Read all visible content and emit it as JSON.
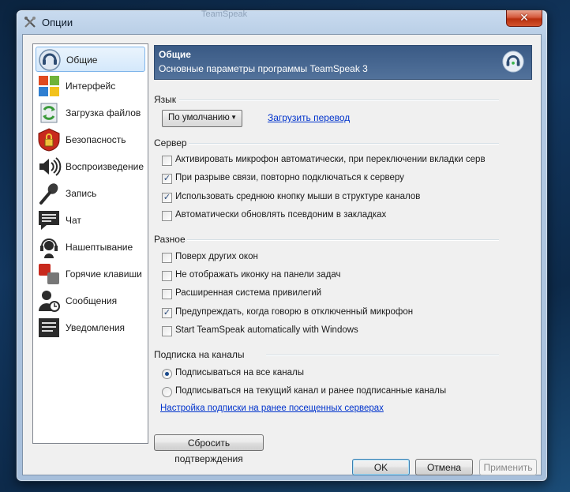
{
  "window": {
    "title": "Опции",
    "ghost_tab": "TeamSpeak",
    "close_symbol": "✕"
  },
  "sidebar": {
    "items": [
      {
        "label": "Общие",
        "icon": "teamspeak-logo-icon",
        "selected": true
      },
      {
        "label": "Интерфейс",
        "icon": "interface-windows-icon"
      },
      {
        "label": "Загрузка файлов",
        "icon": "file-transfer-icon"
      },
      {
        "label": "Безопасность",
        "icon": "security-lock-icon"
      },
      {
        "label": "Воспроизведение",
        "icon": "speaker-icon"
      },
      {
        "label": "Запись",
        "icon": "microphone-icon"
      },
      {
        "label": "Чат",
        "icon": "chat-icon"
      },
      {
        "label": "Нашептывание",
        "icon": "headset-icon"
      },
      {
        "label": "Горячие клавиши",
        "icon": "hotkeys-icon"
      },
      {
        "label": "Сообщения",
        "icon": "messages-user-icon"
      },
      {
        "label": "Уведомления",
        "icon": "notifications-icon"
      }
    ]
  },
  "header": {
    "title": "Общие",
    "subtitle": "Основные параметры программы TeamSpeak 3"
  },
  "language": {
    "group_title": "Язык",
    "dropdown_value": "По умолчанию",
    "load_link": "Загрузить перевод"
  },
  "server": {
    "group_title": "Сервер",
    "options": [
      {
        "label": "Активировать микрофон автоматически, при переключении вкладки серв",
        "checked": false
      },
      {
        "label": "При разрыве связи, повторно подключаться к серверу",
        "checked": true
      },
      {
        "label": "Использовать среднюю кнопку мыши в структуре каналов",
        "checked": true
      },
      {
        "label": "Автоматически обновлять псевдоним в закладках",
        "checked": false
      }
    ]
  },
  "misc": {
    "group_title": "Разное",
    "options": [
      {
        "label": "Поверх других окон",
        "checked": false
      },
      {
        "label": "Не отображать иконку на панели задач",
        "checked": false
      },
      {
        "label": "Расширенная система привилегий",
        "checked": false
      },
      {
        "label": "Предупреждать, когда говорю в отключенный микрофон",
        "checked": true
      },
      {
        "label": "Start TeamSpeak automatically with Windows",
        "checked": false
      }
    ]
  },
  "subscribe": {
    "group_title": "Подписка на каналы",
    "options": [
      {
        "label": "Подписываться на все каналы",
        "selected": true
      },
      {
        "label": "Подписываться на текущий канал и ранее подписанные каналы",
        "selected": false
      }
    ],
    "settings_link": "Настройка подписки на ранее посещенных серверах"
  },
  "buttons": {
    "reset": "Сбросить подтверждения",
    "ok": "OK",
    "cancel": "Отмена",
    "apply": "Применить"
  },
  "colors": {
    "header_bg": "#46678f",
    "link": "#0033cc",
    "accent": "#3c7fb1"
  }
}
